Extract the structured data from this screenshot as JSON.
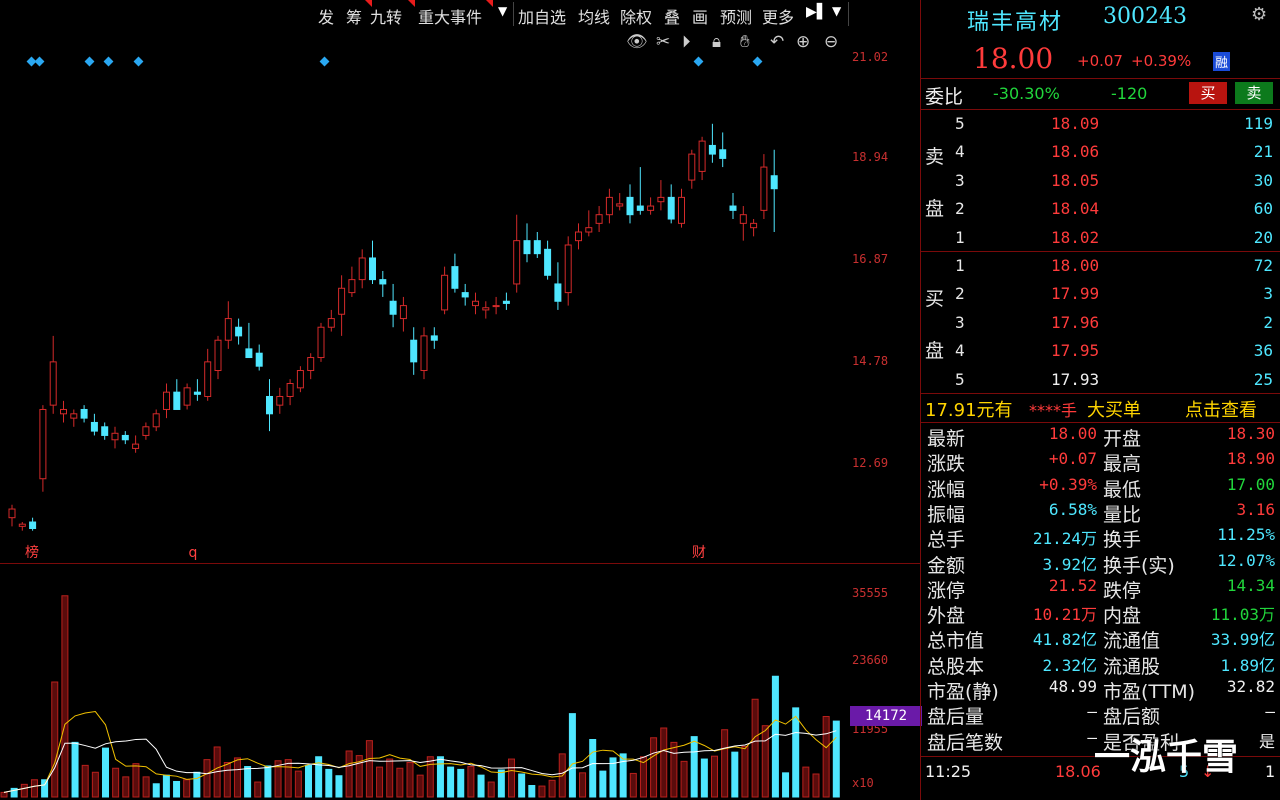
{
  "toolbar": {
    "items": [
      "发",
      "筹",
      "九转",
      "重大事件",
      "加自选",
      "均线",
      "除权",
      "叠",
      "画",
      "预测",
      "更多"
    ],
    "chart_icons": [
      "eye-icon",
      "scissors-icon",
      "play-icon",
      "lock-icon",
      "hand-icon",
      "undo-icon",
      "zoom-in-icon",
      "zoom-out-icon"
    ]
  },
  "stock": {
    "name": "瑞丰高材",
    "code": "300243",
    "price": "18.00",
    "change": "+0.07",
    "change_pct": "+0.39%",
    "badge": "融"
  },
  "weibi": {
    "label": "委比",
    "ratio": "-30.30%",
    "diff": "-120",
    "buy_btn": "买",
    "sell_btn": "卖"
  },
  "sell_label": [
    "卖",
    "盘"
  ],
  "buy_label": [
    "买",
    "盘"
  ],
  "asks": [
    {
      "level": "5",
      "price": "18.09",
      "vol": "119"
    },
    {
      "level": "4",
      "price": "18.06",
      "vol": "21"
    },
    {
      "level": "3",
      "price": "18.05",
      "vol": "30"
    },
    {
      "level": "2",
      "price": "18.04",
      "vol": "60"
    },
    {
      "level": "1",
      "price": "18.02",
      "vol": "20"
    }
  ],
  "bids": [
    {
      "level": "1",
      "price": "18.00",
      "vol": "72"
    },
    {
      "level": "2",
      "price": "17.99",
      "vol": "3"
    },
    {
      "level": "3",
      "price": "17.96",
      "vol": "2"
    },
    {
      "level": "4",
      "price": "17.95",
      "vol": "36"
    },
    {
      "level": "5",
      "price": "17.93",
      "vol": "25"
    }
  ],
  "bigorder": {
    "price_text": "17.91元有",
    "stars": "****手",
    "label": "大买单",
    "link": "点击查看"
  },
  "quote": [
    {
      "l": "最新",
      "v": "18.00",
      "c": "red",
      "l2": "开盘",
      "v2": "18.30",
      "c2": "red"
    },
    {
      "l": "涨跌",
      "v": "+0.07",
      "c": "red",
      "l2": "最高",
      "v2": "18.90",
      "c2": "red"
    },
    {
      "l": "涨幅",
      "v": "+0.39%",
      "c": "red",
      "l2": "最低",
      "v2": "17.00",
      "c2": "green"
    },
    {
      "l": "振幅",
      "v": "6.58%",
      "c": "cyan",
      "l2": "量比",
      "v2": "3.16",
      "c2": "red"
    },
    {
      "l": "总手",
      "v": "21.24万",
      "c": "cyan",
      "l2": "换手",
      "v2": "11.25%",
      "c2": "cyan"
    },
    {
      "l": "金额",
      "v": "3.92亿",
      "c": "cyan",
      "l2": "换手(实)",
      "v2": "12.07%",
      "c2": "cyan"
    },
    {
      "l": "涨停",
      "v": "21.52",
      "c": "red",
      "l2": "跌停",
      "v2": "14.34",
      "c2": "green"
    },
    {
      "l": "外盘",
      "v": "10.21万",
      "c": "red",
      "l2": "内盘",
      "v2": "11.03万",
      "c2": "green"
    },
    {
      "l": "总市值",
      "v": "41.82亿",
      "c": "cyan",
      "l2": "流通值",
      "v2": "33.99亿",
      "c2": "cyan"
    },
    {
      "l": "总股本",
      "v": "2.32亿",
      "c": "cyan",
      "l2": "流通股",
      "v2": "1.89亿",
      "c2": "cyan"
    },
    {
      "l": "市盈(静)",
      "v": "48.99",
      "c": "white",
      "l2": "市盈(TTM)",
      "v2": "32.82",
      "c2": "white"
    },
    {
      "l": "盘后量",
      "v": "–",
      "c": "white",
      "l2": "盘后额",
      "v2": "–",
      "c2": "white"
    },
    {
      "l": "盘后笔数",
      "v": "–",
      "c": "white",
      "l2": "是否盈利",
      "v2": "是",
      "c2": "white"
    }
  ],
  "tick": {
    "time": "11:25",
    "price": "18.06",
    "vol": "5",
    "dir": "1"
  },
  "watermark": "一泓千雪",
  "chart_data": [
    {
      "type": "candlestick",
      "y_ticks": [
        "21.02",
        "18.94",
        "16.87",
        "14.78",
        "12.69"
      ],
      "markers": [
        "榜",
        "q",
        "财"
      ],
      "candles": [
        [
          10.4,
          10.7,
          10.2,
          10.6
        ],
        [
          10.2,
          10.3,
          10.1,
          10.25
        ],
        [
          10.3,
          10.4,
          10.1,
          10.15
        ],
        [
          11.3,
          13.0,
          11.0,
          12.9
        ],
        [
          13.0,
          14.6,
          12.8,
          14.0
        ],
        [
          12.8,
          13.1,
          12.6,
          12.9
        ],
        [
          12.7,
          12.9,
          12.5,
          12.8
        ],
        [
          12.9,
          13.0,
          12.6,
          12.7
        ],
        [
          12.6,
          12.8,
          12.3,
          12.4
        ],
        [
          12.5,
          12.6,
          12.2,
          12.3
        ],
        [
          12.2,
          12.5,
          12.0,
          12.35
        ],
        [
          12.3,
          12.4,
          12.1,
          12.2
        ],
        [
          12.0,
          12.3,
          11.9,
          12.1
        ],
        [
          12.3,
          12.6,
          12.2,
          12.5
        ],
        [
          12.5,
          12.9,
          12.4,
          12.8
        ],
        [
          12.9,
          13.5,
          12.7,
          13.3
        ],
        [
          13.3,
          13.6,
          13.0,
          12.9
        ],
        [
          13.0,
          13.5,
          12.9,
          13.4
        ],
        [
          13.3,
          13.6,
          13.1,
          13.25
        ],
        [
          13.2,
          14.3,
          13.1,
          14.0
        ],
        [
          13.8,
          14.6,
          13.6,
          14.5
        ],
        [
          14.5,
          15.4,
          14.3,
          15.0
        ],
        [
          14.8,
          15.0,
          14.4,
          14.6
        ],
        [
          14.3,
          14.9,
          14.1,
          14.1
        ],
        [
          14.2,
          14.4,
          13.8,
          13.9
        ],
        [
          13.2,
          13.6,
          12.4,
          12.8
        ],
        [
          13.0,
          13.4,
          12.8,
          13.2
        ],
        [
          13.2,
          13.6,
          13.0,
          13.5
        ],
        [
          13.4,
          13.9,
          13.3,
          13.8
        ],
        [
          13.8,
          14.2,
          13.6,
          14.1
        ],
        [
          14.1,
          14.9,
          14.0,
          14.8
        ],
        [
          14.8,
          15.2,
          14.7,
          15.0
        ],
        [
          15.1,
          16.0,
          14.6,
          15.7
        ],
        [
          15.6,
          16.2,
          15.5,
          15.9
        ],
        [
          15.9,
          16.6,
          15.7,
          16.4
        ],
        [
          16.4,
          16.8,
          15.8,
          15.9
        ],
        [
          15.9,
          16.1,
          15.5,
          15.8
        ],
        [
          15.4,
          15.8,
          14.8,
          15.1
        ],
        [
          15.0,
          15.5,
          14.7,
          15.3
        ],
        [
          14.5,
          14.8,
          13.7,
          14.0
        ],
        [
          13.8,
          14.8,
          13.6,
          14.6
        ],
        [
          14.6,
          14.8,
          14.3,
          14.5
        ],
        [
          15.2,
          16.2,
          15.1,
          16.0
        ],
        [
          16.2,
          16.5,
          15.6,
          15.7
        ],
        [
          15.6,
          15.8,
          15.3,
          15.5
        ],
        [
          15.3,
          15.6,
          15.1,
          15.4
        ],
        [
          15.2,
          15.4,
          15.0,
          15.25
        ],
        [
          15.3,
          15.5,
          15.1,
          15.3
        ],
        [
          15.4,
          15.6,
          15.2,
          15.35
        ],
        [
          15.8,
          17.4,
          15.6,
          16.8
        ],
        [
          16.8,
          17.2,
          16.3,
          16.5
        ],
        [
          16.8,
          17.0,
          16.4,
          16.5
        ],
        [
          16.6,
          16.8,
          15.9,
          16.0
        ],
        [
          15.8,
          16.3,
          15.2,
          15.4
        ],
        [
          15.6,
          16.9,
          15.3,
          16.7
        ],
        [
          16.8,
          17.2,
          16.6,
          17.0
        ],
        [
          17.0,
          17.5,
          16.9,
          17.1
        ],
        [
          17.2,
          17.6,
          17.0,
          17.4
        ],
        [
          17.4,
          18.0,
          17.2,
          17.8
        ],
        [
          17.6,
          17.9,
          17.5,
          17.65
        ],
        [
          17.8,
          18.1,
          17.2,
          17.4
        ],
        [
          17.6,
          18.5,
          17.4,
          17.5
        ],
        [
          17.5,
          17.8,
          17.4,
          17.6
        ],
        [
          17.7,
          18.2,
          17.5,
          17.8
        ],
        [
          17.8,
          18.1,
          17.2,
          17.3
        ],
        [
          17.2,
          18.0,
          17.1,
          17.8
        ],
        [
          18.2,
          18.9,
          18.0,
          18.8
        ],
        [
          18.4,
          19.2,
          18.2,
          19.1
        ],
        [
          19.0,
          19.5,
          18.6,
          18.8
        ],
        [
          18.9,
          19.3,
          18.5,
          18.7
        ],
        [
          17.6,
          17.9,
          17.3,
          17.5
        ],
        [
          17.2,
          17.6,
          16.8,
          17.4
        ],
        [
          17.1,
          17.3,
          16.9,
          17.2
        ],
        [
          17.5,
          18.8,
          17.3,
          18.5
        ],
        [
          18.3,
          18.9,
          17.0,
          18.0
        ]
      ],
      "ma_values": [
        [
          11.2,
          11.2,
          11.2,
          11.4,
          11.9,
          12.1,
          12.4,
          12.7,
          12.8,
          12.7,
          12.6,
          12.5,
          12.4,
          12.4,
          12.5,
          12.6,
          12.8,
          13.0,
          13.1,
          13.4,
          13.6,
          13.8,
          14.0,
          14.1,
          14.2,
          14.0,
          13.9,
          13.8,
          13.8,
          13.9,
          14.1,
          14.4,
          14.7,
          15.0,
          15.3,
          15.4,
          15.6,
          15.6,
          15.5,
          15.2,
          15.0,
          14.9,
          15.0,
          15.2,
          15.4,
          15.3,
          15.4,
          15.4,
          15.5,
          15.7,
          15.9,
          16.1,
          16.3,
          16.3,
          16.3,
          16.4,
          16.5,
          16.7,
          16.9,
          17.1,
          17.3,
          17.4,
          17.5,
          17.6,
          17.6,
          17.6,
          17.8,
          18.0,
          18.2,
          18.4,
          18.3,
          18.1,
          17.9,
          17.9,
          17.9
        ],
        [
          10.8,
          10.8,
          10.8,
          10.9,
          11.2,
          11.4,
          11.6,
          11.8,
          11.9,
          12.0,
          12.1,
          12.2,
          12.3,
          12.4,
          12.5,
          12.6,
          12.7,
          12.8,
          12.9,
          13.0,
          13.2,
          13.4,
          13.5,
          13.6,
          13.7,
          13.7,
          13.8,
          13.8,
          13.9,
          14.0,
          14.1,
          14.2,
          14.3,
          14.5,
          14.6,
          14.8,
          14.9,
          15.0,
          15.1,
          15.1,
          15.1,
          15.2,
          15.2,
          15.3,
          15.3,
          15.3,
          15.4,
          15.4,
          15.4,
          15.5,
          15.6,
          15.7,
          15.8,
          15.8,
          15.9,
          16.0,
          16.1,
          16.2,
          16.4,
          16.5,
          16.7,
          16.8,
          16.9,
          17.0,
          17.1,
          17.2,
          17.3,
          17.4,
          17.5,
          17.7,
          17.8,
          17.8,
          17.8,
          17.9,
          17.9
        ]
      ]
    },
    {
      "type": "bar",
      "title": "volume",
      "y_ticks": [
        "35555",
        "23660",
        "11955",
        "x10"
      ],
      "current_label": "14172",
      "values": [
        800,
        1500,
        2200,
        3000,
        3000,
        20000,
        35000,
        9500,
        5500,
        4300,
        8500,
        5000,
        3500,
        5800,
        3500,
        2300,
        3800,
        2700,
        3000,
        4300,
        6500,
        8700,
        6000,
        6800,
        5300,
        2600,
        5400,
        6300,
        6500,
        4500,
        5500,
        7000,
        4800,
        3700,
        8000,
        7200,
        9800,
        5200,
        6600,
        5000,
        6000,
        3800,
        7000,
        7000,
        5200,
        4800,
        5300,
        3800,
        2600,
        4700,
        6600,
        4000,
        2000,
        1900,
        2900,
        7500,
        14500,
        4200,
        10000,
        4500,
        6800,
        7500,
        4100,
        7000,
        10300,
        12000,
        9500,
        6200,
        10500,
        6600,
        7100,
        11700,
        7800,
        8800,
        17000,
        12400,
        21000,
        4200,
        15500,
        5200,
        4000,
        14000,
        13200
      ]
    }
  ]
}
